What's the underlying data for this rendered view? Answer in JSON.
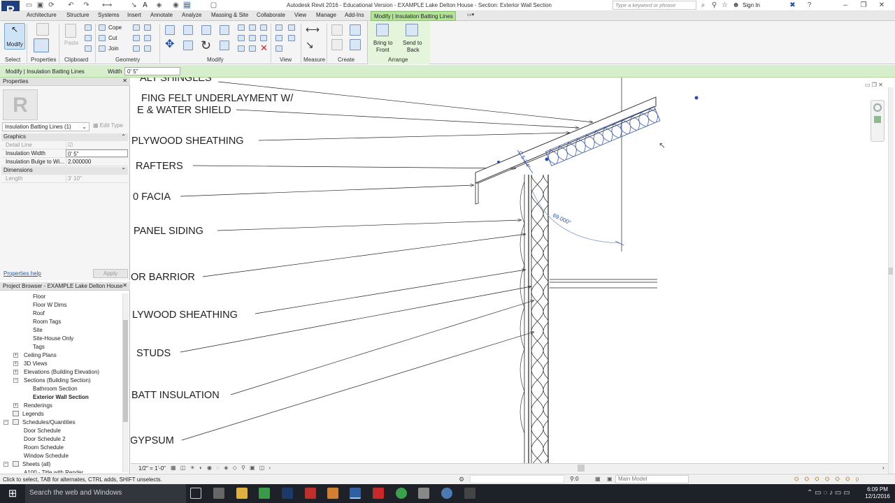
{
  "titlebar": {
    "title": "Autodesk Revit 2016 - Educational Version -    EXAMPLE Lake Delton House - Section: Exterior Wall Section",
    "search_placeholder": "Type a keyword or phrase",
    "sign_in": "Sign In",
    "app_letter": "R"
  },
  "tabs": [
    "Architecture",
    "Structure",
    "Systems",
    "Insert",
    "Annotate",
    "Analyze",
    "Massing & Site",
    "Collaborate",
    "View",
    "Manage",
    "Add-Ins"
  ],
  "context_tab": "Modify | Insulation Batting Lines",
  "ribbon": {
    "modify": "Modify",
    "paste": "Paste",
    "cope": "Cope",
    "cut": "Cut",
    "join": "Join",
    "bring_front_1": "Bring to",
    "bring_front_2": "Front",
    "send_back_1": "Send to",
    "send_back_2": "Back",
    "panels": [
      "Select",
      "Properties",
      "Clipboard",
      "Geometry",
      "Modify",
      "View",
      "Measure",
      "Create",
      "Arrange"
    ]
  },
  "options_bar": {
    "title": "Modify | Insulation Batting Lines",
    "width_label": "Width",
    "width_value": "0'  5\""
  },
  "properties": {
    "header": "Properties",
    "type_selector": "Insulation Batting Lines (1)",
    "edit_type": "Edit Type",
    "groups": {
      "graphics": "Graphics",
      "dimensions": "Dimensions"
    },
    "rows": {
      "detail_line": "Detail Line",
      "insulation_width": "Insulation Width",
      "insulation_width_val": "0'  5\"",
      "bulge": "Insulation Bulge to Wi...",
      "bulge_val": "2.000000",
      "length": "Length",
      "length_val": "3'  10\""
    },
    "help": "Properties help",
    "apply": "Apply"
  },
  "browser": {
    "header": "Project Browser - EXAMPLE Lake Delton House",
    "items": [
      "Floor",
      "Floor W Dims",
      "Roof",
      "Room Tags",
      "Site",
      "Site-House Only",
      "Tags",
      "Ceiling Plans",
      "3D Views",
      "Elevations (Building Elevation)",
      "Sections (Building Section)",
      "Bathroom Section",
      "Exterior Wall Section",
      "Renderings",
      "Legends",
      "Schedules/Quantities",
      "Door Schedule",
      "Door Schedule 2",
      "Room Schedule",
      "Window Schedule",
      "Sheets (all)",
      "A100 - Title with Render"
    ]
  },
  "drawing": {
    "labels": [
      "ALT SHINGLES",
      "FING FELT UNDERLAYMENT W/",
      "E & WATER SHIELD",
      "PLYWOOD SHEATHING",
      "RAFTERS",
      "0 FACIA",
      "PANEL SIDING",
      "OR BARRIOR",
      "LYWOOD SHEATHING",
      "STUDS",
      "BATT INSULATION",
      "GYPSUM"
    ],
    "dim_text": "0'  5 3/4\"",
    "angle_text": "69.000°"
  },
  "view_control": {
    "scale": "1/2\" = 1'-0\""
  },
  "status": {
    "text": "Click to select, TAB for alternates, CTRL adds, SHIFT unselects.",
    "coord": ":0",
    "model": "Main Model"
  },
  "taskbar": {
    "search": "Search the web and Windows",
    "time": "6:09 PM",
    "date": "12/1/2016"
  }
}
